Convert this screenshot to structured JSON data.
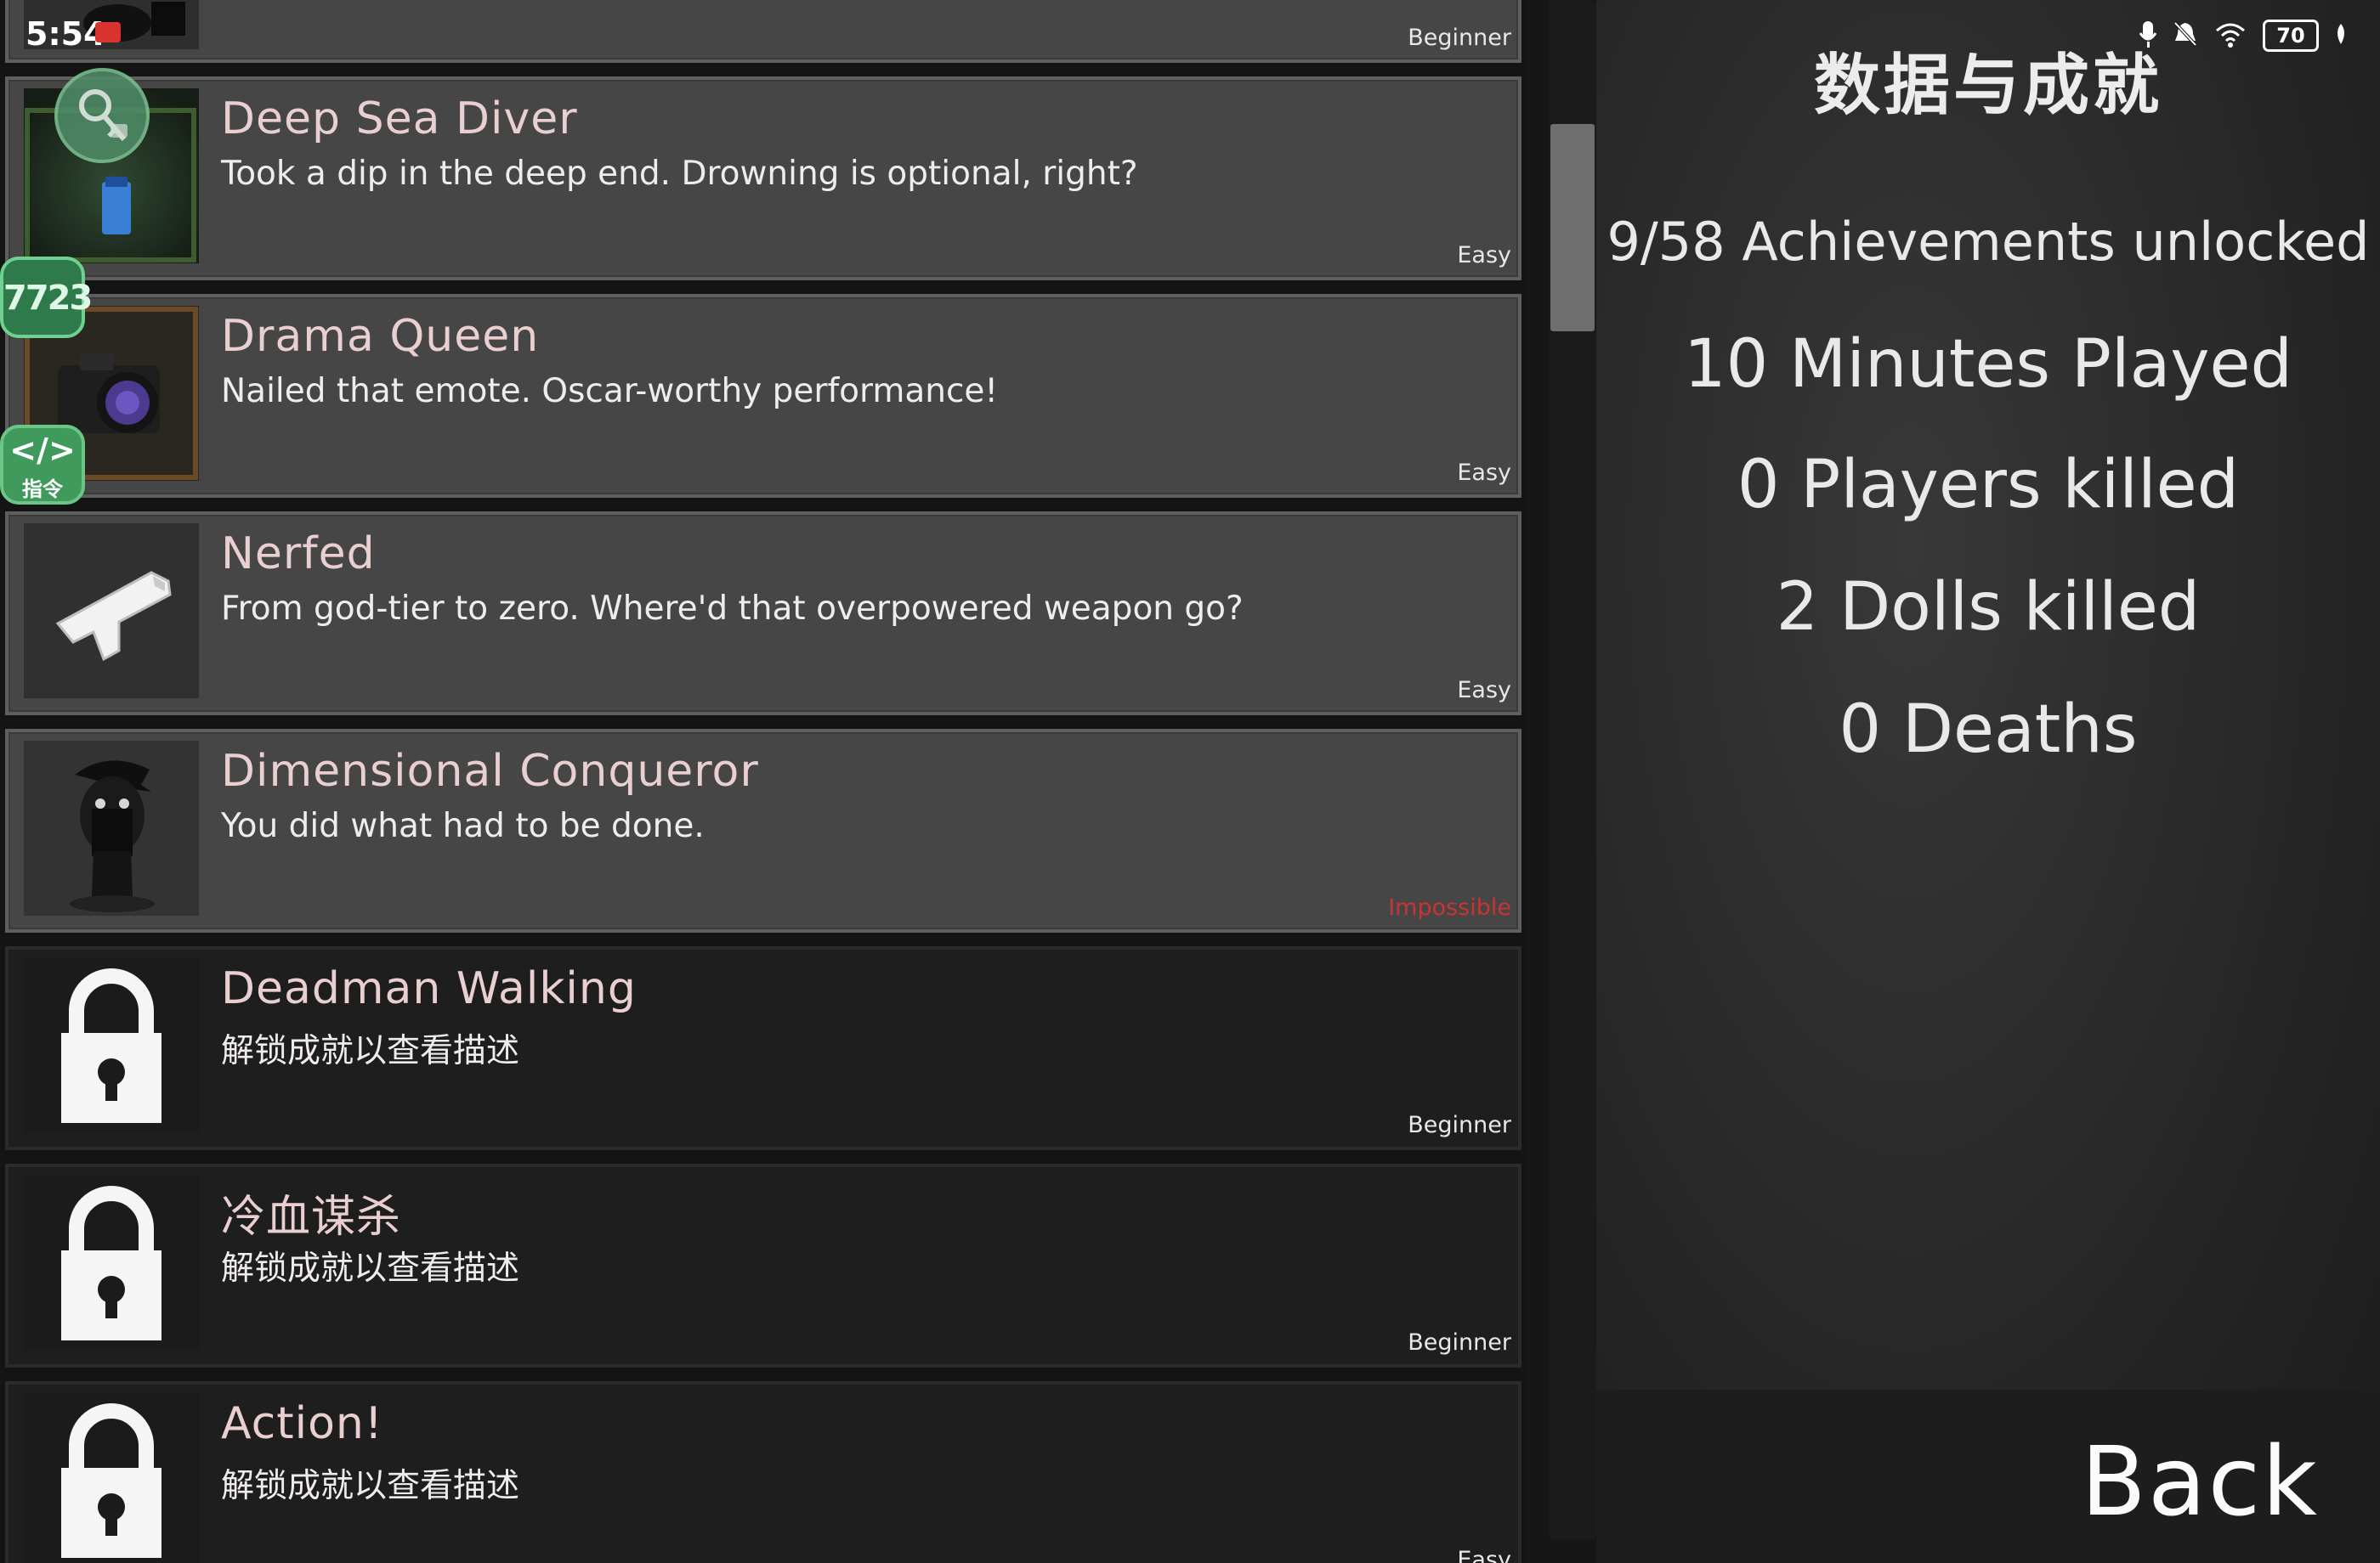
{
  "status_bar": {
    "time": "5:54",
    "battery": "70"
  },
  "achievements": [
    {
      "title": "",
      "description": "",
      "difficulty": "Beginner",
      "locked": false,
      "icon": "figure-head-icon"
    },
    {
      "title": "Deep Sea Diver",
      "description": "Took a dip in the deep end. Drowning is optional, right?",
      "difficulty": "Easy",
      "locked": false,
      "icon": "diving-bottle-icon"
    },
    {
      "title": "Drama Queen",
      "description": "Nailed that emote. Oscar-worthy performance!",
      "difficulty": "Easy",
      "locked": false,
      "icon": "camera-icon"
    },
    {
      "title": "Nerfed",
      "description": "From god-tier to zero. Where'd that overpowered weapon go?",
      "difficulty": "Easy",
      "locked": false,
      "icon": "toy-gun-icon"
    },
    {
      "title": "Dimensional Conqueror",
      "description": "You did what had to be done.",
      "difficulty": "Impossible",
      "locked": false,
      "icon": "masked-figure-icon"
    },
    {
      "title": "Deadman Walking",
      "description": "解锁成就以查看描述",
      "difficulty": "Beginner",
      "locked": true,
      "icon": "padlock-icon"
    },
    {
      "title": "冷血谋杀",
      "description": "解锁成就以查看描述",
      "difficulty": "Beginner",
      "locked": true,
      "icon": "padlock-icon"
    },
    {
      "title": "Action!",
      "description": "解锁成就以查看描述",
      "difficulty": "Easy",
      "locked": true,
      "icon": "padlock-icon"
    }
  ],
  "stats": {
    "title": "数据与成就",
    "achievements_unlocked": "9/58 Achievements unlocked",
    "minutes_played": "10 Minutes Played",
    "players_killed": "0 Players killed",
    "dolls_killed": "2 Dolls killed",
    "deaths": "0 Deaths",
    "back_label": "Back"
  },
  "overlay": {
    "badge_7723": "7723",
    "command_code": "</>",
    "command_label": "指令"
  },
  "colors": {
    "impossible": "#c83333",
    "title_pink": "#e9cfcf",
    "unlocked_row": "#464646",
    "locked_row": "#1e1e1e"
  }
}
